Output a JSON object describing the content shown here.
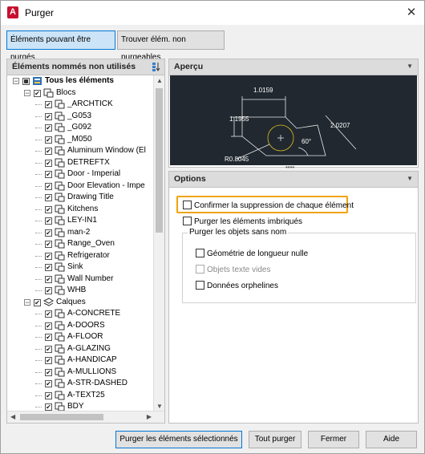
{
  "window": {
    "title": "Purger",
    "app_icon": "A"
  },
  "tabs": [
    {
      "label": "Éléments pouvant être purgés",
      "active": true
    },
    {
      "label": "Trouver élém. non purgeables",
      "active": false
    }
  ],
  "tree": {
    "header": "Éléments nommés non utilisés",
    "root": "Tous les éléments",
    "groups": [
      {
        "label": "Blocs",
        "items": [
          "_ARCHTICK",
          "_G053",
          "_G092",
          "_M050",
          "Aluminum Window (El",
          "DETREFTX",
          "Door - Imperial",
          "Door Elevation - Impe",
          "Drawing Title",
          "Kitchens",
          "LEY-IN1",
          "man-2",
          "Range_Oven",
          "Refrigerator",
          "Sink",
          "Wall Number",
          "WHB"
        ]
      },
      {
        "label": "Calques",
        "items": [
          "A-CONCRETE",
          "A-DOORS",
          "A-FLOOR",
          "A-GLAZING",
          "A-HANDICAP",
          "A-MULLIONS",
          "A-STR-DASHED",
          "A-TEXT25",
          "BDY"
        ]
      }
    ]
  },
  "preview": {
    "header": "Aperçu",
    "dims": {
      "top": "1.0159",
      "left": "1.1955",
      "right": "2.0207",
      "angle": "60°",
      "radius": "R0.8045"
    }
  },
  "options": {
    "header": "Options",
    "confirm": "Confirmer la suppression de chaque élément",
    "nested": "Purger les éléments imbriqués",
    "group_title": "Purger les objets sans nom",
    "zero_geom": "Géométrie de longueur nulle",
    "empty_text": "Objets texte vides",
    "orphan": "Données orphelines"
  },
  "buttons": {
    "purge_selected": "Purger les éléments sélectionnés",
    "purge_all": "Tout purger",
    "close": "Fermer",
    "help": "Aide"
  }
}
